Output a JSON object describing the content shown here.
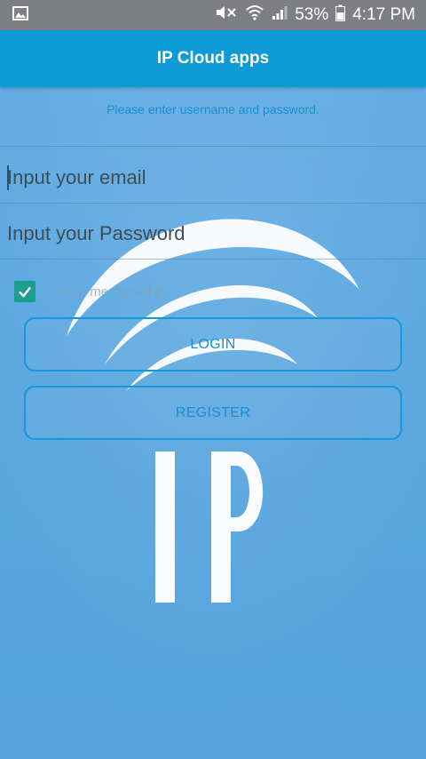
{
  "status_bar": {
    "battery_percent": "53%",
    "time": "4:17 PM",
    "icons": [
      "image-notification-icon",
      "mute-icon",
      "wifi-icon",
      "signal-icon",
      "battery-icon"
    ]
  },
  "app_bar": {
    "title": "IP Cloud apps"
  },
  "login_form": {
    "prompt": "Please enter username and password.",
    "email_placeholder": "Input your email",
    "password_placeholder": "Input your Password",
    "keep_signed_in_label": "Keep me signed in",
    "keep_signed_in_checked": true,
    "login_label": "LOGIN",
    "register_label": "REGISTER"
  },
  "background_logo": {
    "text": "IP"
  },
  "colors": {
    "status_bar": "#7d7f83",
    "app_bar": "#0d9ad5",
    "background": "#5aa7e0",
    "accent": "#1597d8",
    "checkbox": "#1e9e90"
  }
}
